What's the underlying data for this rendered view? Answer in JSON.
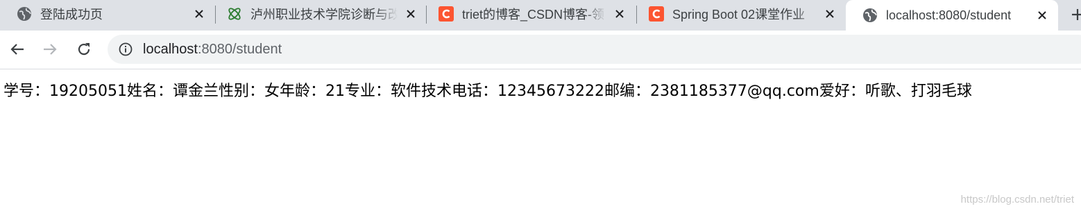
{
  "tabs": [
    {
      "title": "登陆成功页",
      "icon": "globe-icon",
      "active": false
    },
    {
      "title": "泸州职业技术学院诊断与改",
      "icon": "atom-icon",
      "active": false
    },
    {
      "title": "triet的博客_CSDN博客-领",
      "icon": "csdn-icon",
      "active": false
    },
    {
      "title": "Spring Boot 02课堂作业",
      "icon": "csdn-icon",
      "active": false
    },
    {
      "title": "localhost:8080/student",
      "icon": "globe-icon",
      "active": true
    }
  ],
  "colors": {
    "tabstrip_bg": "#dee1e6",
    "csdn_red": "#fc5531",
    "atom_green": "#2e7d32"
  },
  "address_bar": {
    "host": "localhost",
    "rest": ":8080/student"
  },
  "page": {
    "student_line": "学号：19205051姓名：谭金兰性别：女年龄：21专业：软件技术电话：12345673222邮编：2381185377@qq.com爱好：听歌、打羽毛球"
  },
  "watermark": "https://blog.csdn.net/triet"
}
